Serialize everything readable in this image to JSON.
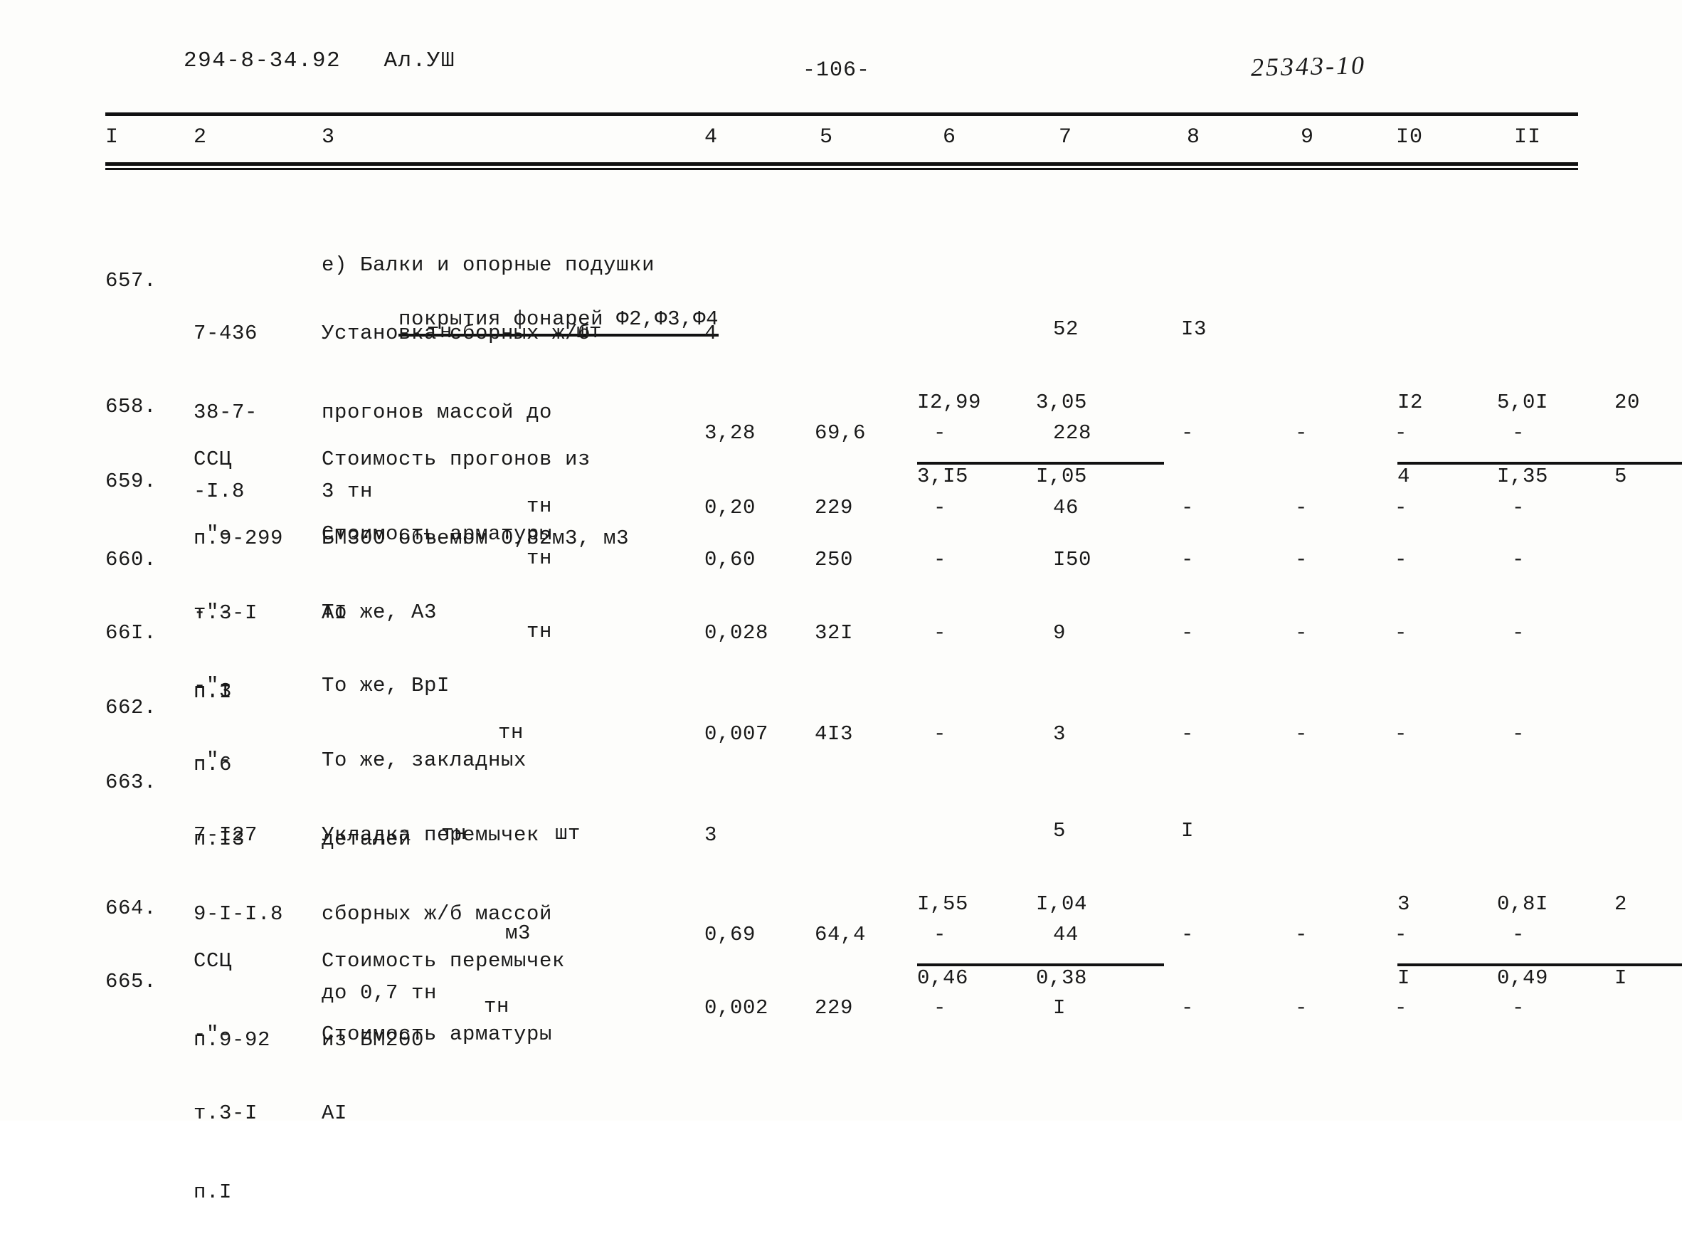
{
  "header": {
    "left": "294-8-34.92   Ал.УШ",
    "page_number": "-106-",
    "handwritten_code": "25343-10"
  },
  "table": {
    "column_numbers": [
      "I",
      "2",
      "3",
      "4",
      "5",
      "6",
      "7",
      "8",
      "9",
      "I0",
      "II"
    ],
    "section_heading": {
      "line1": "е) Балки и опорные подушки",
      "line2": "покрытия фонарей Ф2,Ф3,Ф4"
    },
    "rows": [
      {
        "no": "657.",
        "code_lines": [
          "7-436",
          "38-7-",
          "-I.8"
        ],
        "desc_lines": [
          "Установка сборных ж/б",
          "прогонов массой до",
          "3 тн"
        ],
        "unit": "шт",
        "c4": "4",
        "c5_num": "I2,99",
        "c5_den": "3,I5",
        "c6_num": "3,05",
        "c6_den": "I,05",
        "c7": "52",
        "c8": "I3",
        "c9_num": "I2",
        "c9_den": "4",
        "c10_num": "5,0I",
        "c10_den": "I,35",
        "c11_num": "20",
        "c11_den": "5"
      },
      {
        "no": "658.",
        "code_lines": [
          "ССЦ",
          "п.9-299"
        ],
        "desc_lines": [
          "Стоимость прогонов из",
          "БМ300 объемом 0,82м3, м3"
        ],
        "unit": "",
        "c4": "3,28",
        "c5": "69,6",
        "c6": "-",
        "c7": "228",
        "c8": "-",
        "c9": "-",
        "c10": "-",
        "c11": "-"
      },
      {
        "no": "659.",
        "code_lines": [
          "-\"-",
          "т.3-I",
          "п.I"
        ],
        "desc_lines": [
          "Стоимость арматуры",
          "AI"
        ],
        "unit": "тн",
        "c4": "0,20",
        "c5": "229",
        "c6": "-",
        "c7": "46",
        "c8": "-",
        "c9": "-",
        "c10": "-",
        "c11": "-"
      },
      {
        "no": "660.",
        "code_lines": [
          "-\"-",
          "п.3"
        ],
        "desc_lines": [
          "То же, А3"
        ],
        "unit": "тн",
        "c4": "0,60",
        "c5": "250",
        "c6": "-",
        "c7": "I50",
        "c8": "-",
        "c9": "-",
        "c10": "-",
        "c11": "-"
      },
      {
        "no": "66I.",
        "code_lines": [
          "-\"-",
          "п.6"
        ],
        "desc_lines": [
          "То же, ВрI"
        ],
        "unit": "тн",
        "c4": "0,028",
        "c5": "32I",
        "c6": "-",
        "c7": "9",
        "c8": "-",
        "c9": "-",
        "c10": "-",
        "c11": "-"
      },
      {
        "no": "662.",
        "code_lines": [
          "-\"-",
          "п.I3"
        ],
        "desc_lines": [
          "То же, закладных",
          "деталей"
        ],
        "unit": "тн",
        "c4": "0,007",
        "c5": "4I3",
        "c6": "-",
        "c7": "3",
        "c8": "-",
        "c9": "-",
        "c10": "-",
        "c11": "-"
      },
      {
        "no": "663.",
        "code_lines": [
          "7-I27",
          "9-I-I.8"
        ],
        "desc_lines": [
          "Укладка перемычек",
          "сборных ж/б массой",
          "до 0,7 тн"
        ],
        "unit": "шт",
        "c4": "3",
        "c5_num": "I,55",
        "c5_den": "0,46",
        "c6_num": "I,04",
        "c6_den": "0,38",
        "c7": "5",
        "c8": "I",
        "c9_num": "3",
        "c9_den": "I",
        "c10_num": "0,8I",
        "c10_den": "0,49",
        "c11_num": "2",
        "c11_den": "I"
      },
      {
        "no": "664.",
        "code_lines": [
          "ССЦ",
          "п.9-92"
        ],
        "desc_lines": [
          "Стоимость перемычек",
          "из БМ200"
        ],
        "unit": "м3",
        "c4": "0,69",
        "c5": "64,4",
        "c6": "-",
        "c7": "44",
        "c8": "-",
        "c9": "-",
        "c10": "-",
        "c11": "-"
      },
      {
        "no": "665.",
        "code_lines": [
          "-\"-",
          "т.3-I",
          "п.I"
        ],
        "desc_lines": [
          "Стоимость арматуры",
          "AI"
        ],
        "unit": "тн",
        "c4": "0,002",
        "c5": "229",
        "c6": "-",
        "c7": "I",
        "c8": "-",
        "c9": "-",
        "c10": "-",
        "c11": "-"
      }
    ]
  }
}
